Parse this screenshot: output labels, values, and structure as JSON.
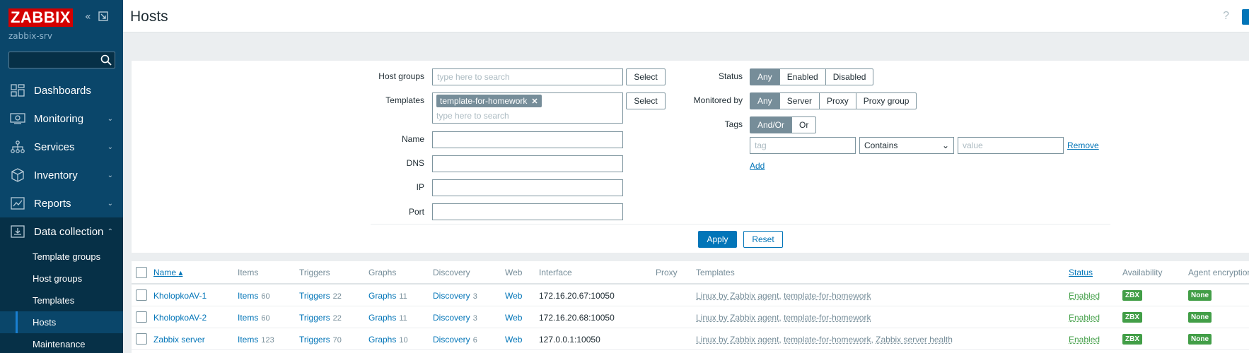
{
  "app": {
    "logo": "ZABBIX",
    "server": "zabbix-srv"
  },
  "sidebar": {
    "search_placeholder": "",
    "items": [
      {
        "label": "Dashboards",
        "icon": "dashboards-icon"
      },
      {
        "label": "Monitoring",
        "icon": "monitoring-icon"
      },
      {
        "label": "Services",
        "icon": "services-icon"
      },
      {
        "label": "Inventory",
        "icon": "inventory-icon"
      },
      {
        "label": "Reports",
        "icon": "reports-icon"
      },
      {
        "label": "Data collection",
        "icon": "data-collection-icon"
      }
    ],
    "sub_items": [
      "Template groups",
      "Host groups",
      "Templates",
      "Hosts",
      "Maintenance"
    ]
  },
  "header": {
    "title": "Hosts",
    "help": "?"
  },
  "filter": {
    "host_groups_label": "Host groups",
    "host_groups_placeholder": "type here to search",
    "templates_label": "Templates",
    "templates_chip": "template-for-homework",
    "templates_placeholder": "type here to search",
    "name_label": "Name",
    "dns_label": "DNS",
    "ip_label": "IP",
    "port_label": "Port",
    "select_label": "Select",
    "status_label": "Status",
    "status_options": [
      "Any",
      "Enabled",
      "Disabled"
    ],
    "monitored_label": "Monitored by",
    "monitored_options": [
      "Any",
      "Server",
      "Proxy",
      "Proxy group"
    ],
    "tags_label": "Tags",
    "tags_options": [
      "And/Or",
      "Or"
    ],
    "tag_placeholder": "tag",
    "tag_operator": "Contains",
    "value_placeholder": "value",
    "remove_label": "Remove",
    "add_label": "Add",
    "apply_label": "Apply",
    "reset_label": "Reset"
  },
  "table": {
    "headers": [
      "Name",
      "Items",
      "Triggers",
      "Graphs",
      "Discovery",
      "Web",
      "Interface",
      "Proxy",
      "Templates",
      "Status",
      "Availability",
      "Agent encryption"
    ],
    "rows": [
      {
        "name": "KholopkoAV-1",
        "items": "Items",
        "items_n": "60",
        "triggers": "Triggers",
        "triggers_n": "22",
        "graphs": "Graphs",
        "graphs_n": "11",
        "discovery": "Discovery",
        "discovery_n": "3",
        "web": "Web",
        "interface": "172.16.20.67:10050",
        "tpl1": "Linux by Zabbix agent",
        "tpl2": "template-for-homework",
        "tpl3": "",
        "status": "Enabled",
        "avail": "ZBX",
        "enc": "None"
      },
      {
        "name": "KholopkoAV-2",
        "items": "Items",
        "items_n": "60",
        "triggers": "Triggers",
        "triggers_n": "22",
        "graphs": "Graphs",
        "graphs_n": "11",
        "discovery": "Discovery",
        "discovery_n": "3",
        "web": "Web",
        "interface": "172.16.20.68:10050",
        "tpl1": "Linux by Zabbix agent",
        "tpl2": "template-for-homework",
        "tpl3": "",
        "status": "Enabled",
        "avail": "ZBX",
        "enc": "None"
      },
      {
        "name": "Zabbix server",
        "items": "Items",
        "items_n": "123",
        "triggers": "Triggers",
        "triggers_n": "70",
        "graphs": "Graphs",
        "graphs_n": "10",
        "discovery": "Discovery",
        "discovery_n": "6",
        "web": "Web",
        "interface": "127.0.0.1:10050",
        "tpl1": "Linux by Zabbix agent",
        "tpl2": "template-for-homework",
        "tpl3": "Zabbix server health",
        "status": "Enabled",
        "avail": "ZBX",
        "enc": "None"
      }
    ]
  },
  "colors": {
    "sidebar": "#0a466a",
    "accent": "#0275b8",
    "logo": "#d40000",
    "enabled": "#429e47"
  }
}
